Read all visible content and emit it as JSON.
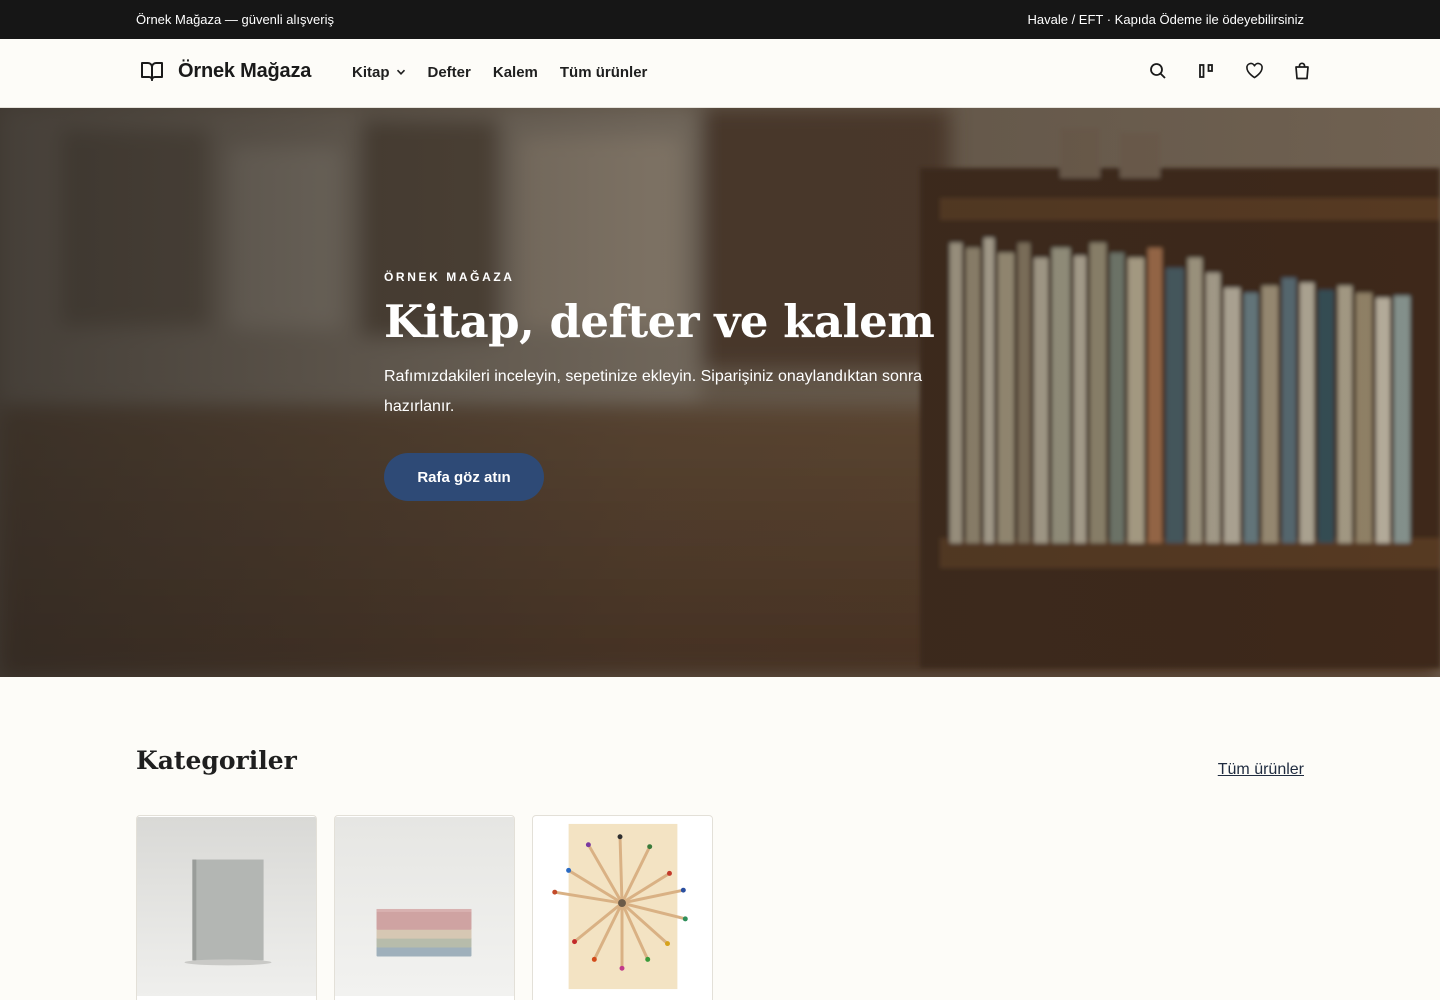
{
  "topbar": {
    "left_text": "Örnek Mağaza — güvenli alışveriş",
    "right_text": "Havale / EFT · Kapıda Ödeme ile ödeyebilirsiniz"
  },
  "header": {
    "logo_icon": "open-book-icon",
    "logo_text": "Örnek Mağaza",
    "nav": [
      {
        "label": "Kitap",
        "has_dropdown": true
      },
      {
        "label": "Defter"
      },
      {
        "label": "Kalem"
      },
      {
        "label": "Tüm ürünler"
      }
    ],
    "actions": [
      "search-icon",
      "compare-icon",
      "heart-icon",
      "shopping-bag-icon"
    ]
  },
  "hero": {
    "eyebrow": "ÖRNEK MAĞAZA",
    "title": "Kitap, defter ve kalem",
    "subtitle": "Rafımızdakileri inceleyin, sepetinize ekleyin. Siparişiniz onaylandıktan sonra hazırlanır.",
    "cta": "Rafa göz atın",
    "cta_color": "#2e4a76"
  },
  "categories": {
    "title": "Kategoriler",
    "all_link": "Tüm ürünler"
  },
  "colors": {
    "topbar_bg": "#161616",
    "page_bg": "#fdfcf8",
    "link": "#1f2b3f"
  }
}
